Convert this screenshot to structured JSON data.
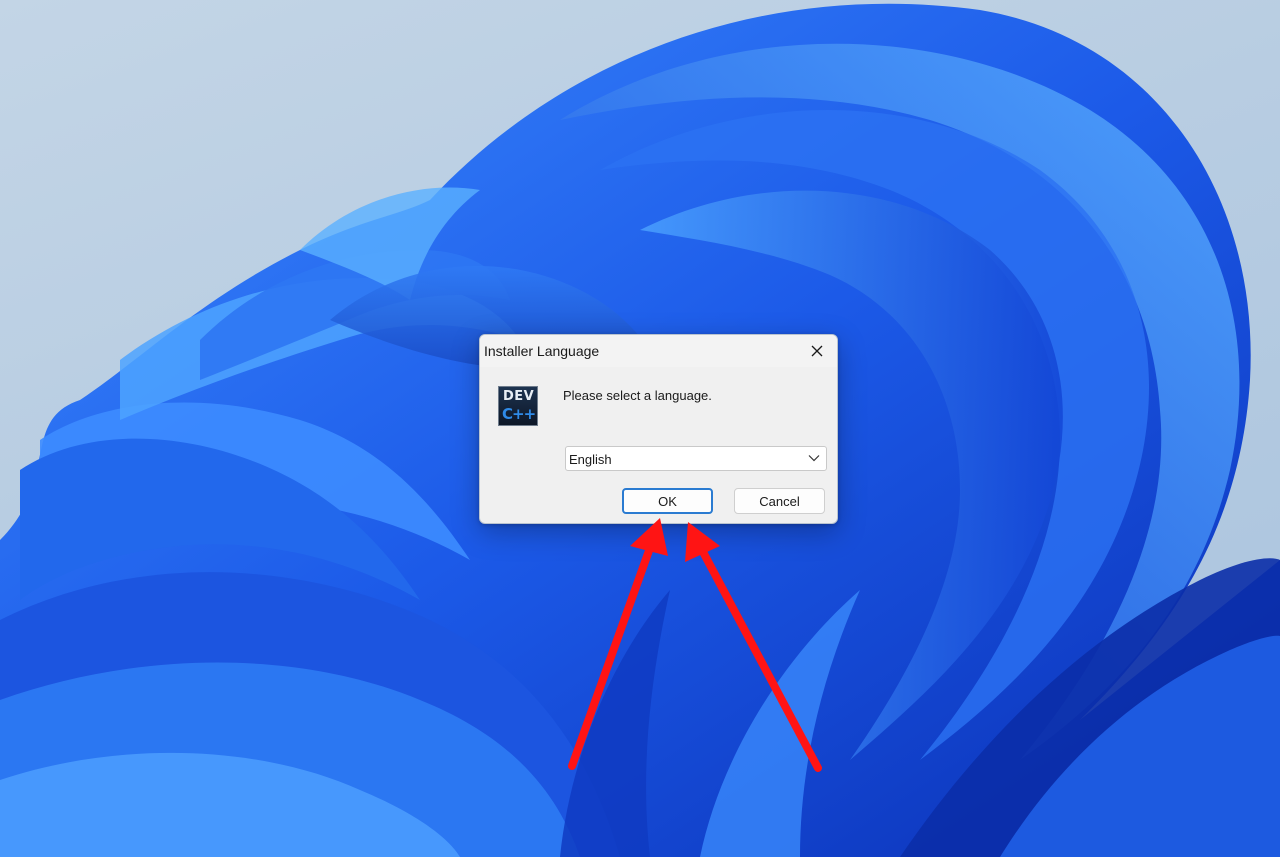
{
  "dialog": {
    "title": "Installer Language",
    "prompt": "Please select a language.",
    "app_icon": "dev-cpp-logo",
    "app_icon_text_top": "DEV",
    "app_icon_text_bottom": "C++",
    "language_select": {
      "selected": "English"
    },
    "ok_label": "OK",
    "cancel_label": "Cancel",
    "close_icon": "close-icon"
  },
  "colors": {
    "wallpaper_blue": "#1f5fe6",
    "focus_blue": "#2a7bd1",
    "annotation_red": "#ff1414"
  }
}
